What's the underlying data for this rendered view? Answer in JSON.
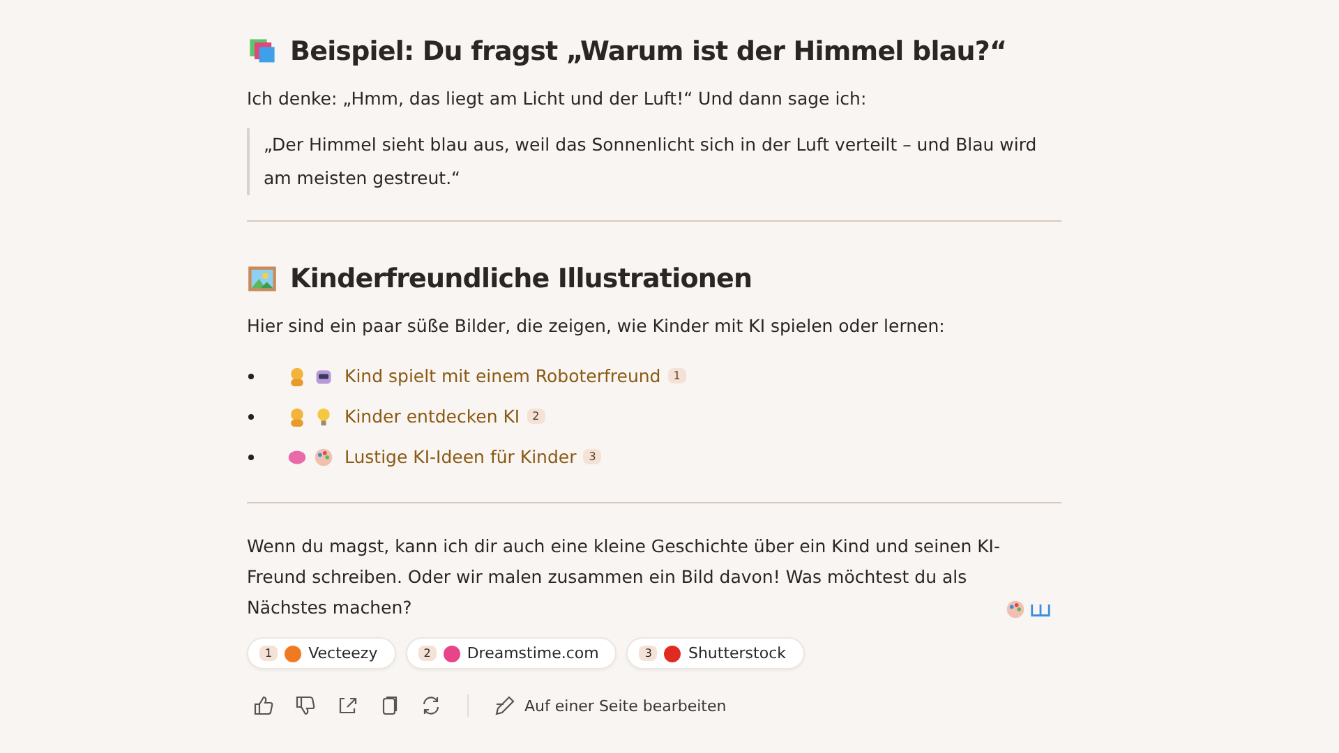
{
  "section_1": {
    "heading": "Beispiel: Du fragst „Warum ist der Himmel blau?“",
    "intro": "Ich denke: „Hmm, das liegt am Licht und der Luft!“ Und dann sage ich:",
    "quote": "„Der Himmel sieht blau aus, weil das Sonnenlicht sich in der Luft verteilt – und Blau wird am meisten gestreut.“"
  },
  "section_2": {
    "heading": "Kinderfreundliche Illustrationen",
    "intro": "Hier sind ein paar süße Bilder, die zeigen, wie Kinder mit KI spielen oder lernen:",
    "items": [
      {
        "label": "Kind spielt mit einem Roboterfreund",
        "citation": "1"
      },
      {
        "label": "Kinder entdecken KI",
        "citation": "2"
      },
      {
        "label": "Lustige KI-Ideen für Kinder",
        "citation": "3"
      }
    ]
  },
  "closing": "Wenn du magst, kann ich dir auch eine kleine Geschichte über ein Kind und seinen KI-Freund schreiben. Oder wir malen zusammen ein Bild davon! Was möchtest du als Nächstes machen?",
  "sources": [
    {
      "number": "1",
      "name": "Vecteezy",
      "color": "#f07a22"
    },
    {
      "number": "2",
      "name": "Dreamstime.com",
      "color": "#e8448a"
    },
    {
      "number": "3",
      "name": "Shutterstock",
      "color": "#e02b20"
    }
  ],
  "actions": {
    "edit_label": "Auf einer Seite bearbeiten"
  }
}
